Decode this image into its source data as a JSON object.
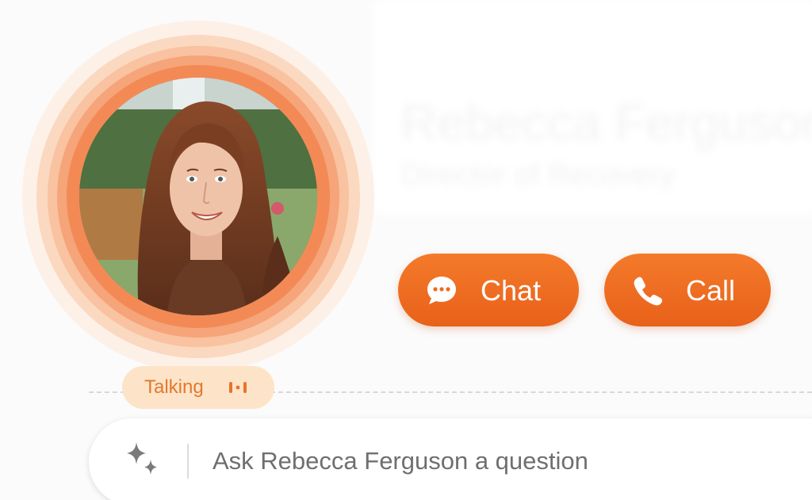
{
  "profile": {
    "name": "Rebecca Ferguson",
    "title": "Director of Recovery",
    "status_label": "Talking",
    "status_icon": "audio-wave-icon",
    "avatar_alt": "Rebecca Ferguson avatar"
  },
  "actions": {
    "chat_label": "Chat",
    "chat_icon": "chat-bubble-icon",
    "call_label": "Call",
    "call_icon": "phone-icon"
  },
  "ask": {
    "placeholder": "Ask Rebecca Ferguson a question",
    "value": "",
    "icon": "sparkle-icon"
  },
  "colors": {
    "accent": "#ef6c22",
    "badge_bg": "#fde3c8",
    "badge_text": "#e07a2e"
  }
}
